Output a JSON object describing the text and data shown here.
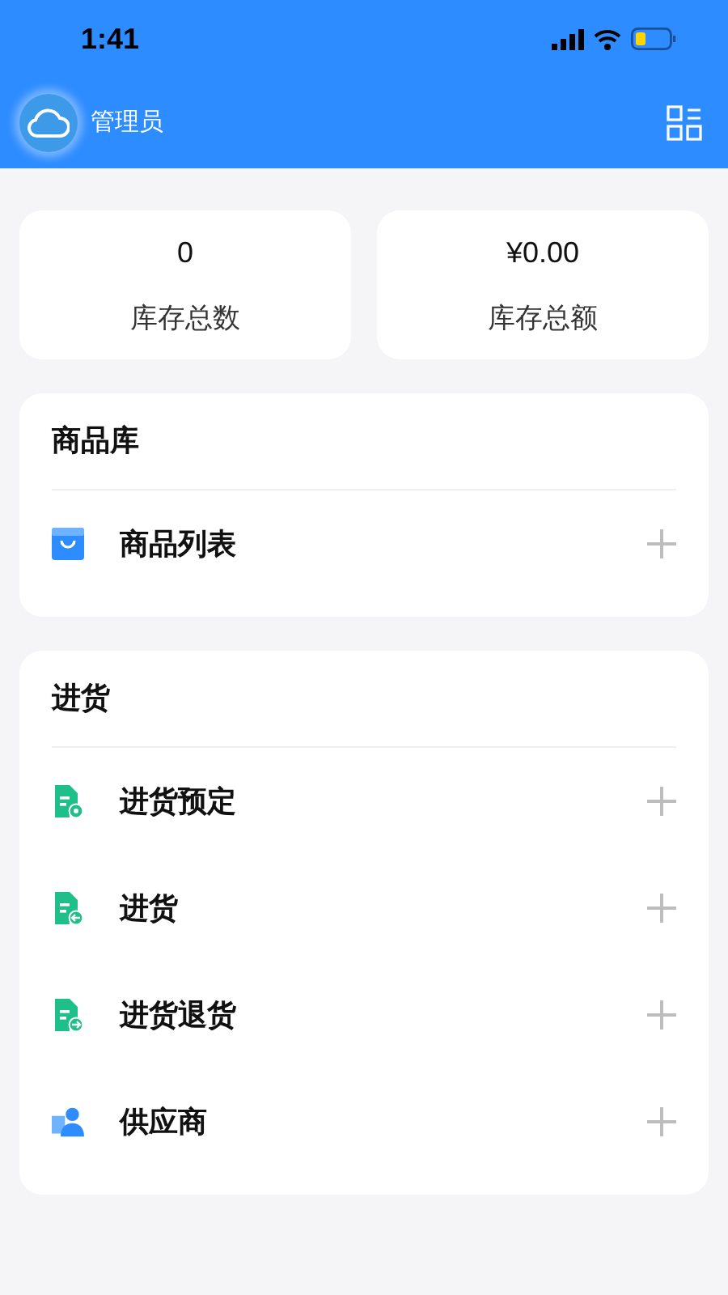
{
  "status_bar": {
    "time": "1:41"
  },
  "header": {
    "title": "管理员"
  },
  "stats": [
    {
      "value": "0",
      "label": "库存总数"
    },
    {
      "value": "¥0.00",
      "label": "库存总额"
    }
  ],
  "sections": [
    {
      "title": "商品库",
      "items": [
        {
          "label": "商品列表",
          "kind": "bag"
        }
      ]
    },
    {
      "title": "进货",
      "items": [
        {
          "label": "进货预定",
          "kind": "doc-dot"
        },
        {
          "label": "进货",
          "kind": "doc-in"
        },
        {
          "label": "进货退货",
          "kind": "doc-out"
        },
        {
          "label": "供应商",
          "kind": "person"
        }
      ]
    }
  ]
}
